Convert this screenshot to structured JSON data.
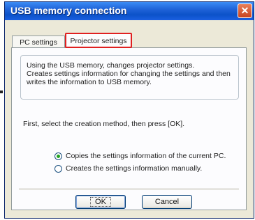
{
  "window": {
    "title": "USB memory connection",
    "close_glyph": "✕"
  },
  "tabs": [
    {
      "label": "PC settings",
      "active": false
    },
    {
      "label": "Projector settings",
      "active": true
    }
  ],
  "info": {
    "lines": [
      "Using the USB memory, changes projector settings.",
      "Creates settings information for changing the settings and then",
      "writes the information to USB memory."
    ]
  },
  "instruction": "First, select the creation method, then press [OK].",
  "options": [
    {
      "label": "Copies the settings information of the current PC.",
      "checked": true
    },
    {
      "label": "Creates the settings information manually.",
      "checked": false
    }
  ],
  "buttons": {
    "ok": "OK",
    "cancel": "Cancel"
  },
  "colors": {
    "title_bar": "#0c52c9",
    "highlight": "#e02020",
    "dialog_bg": "#ece9d8"
  }
}
